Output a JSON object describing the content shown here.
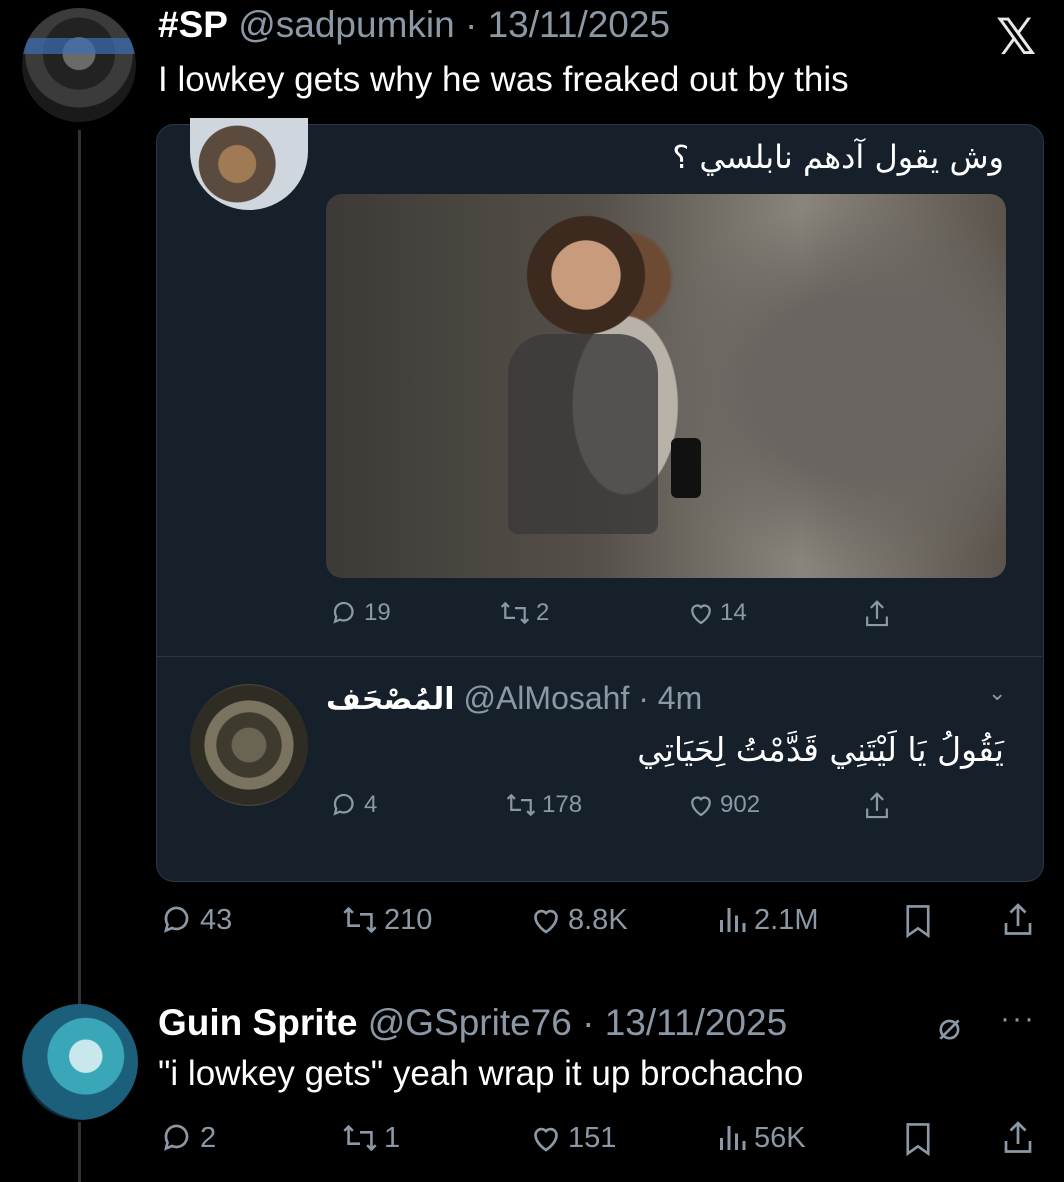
{
  "tweet1": {
    "name": "#SP",
    "handle": "@sadpumkin",
    "dot": " · ",
    "date": "13/11/2025",
    "text": "I lowkey gets why he was freaked out by this",
    "platform_logo": "𝕏",
    "stats": {
      "replies": "43",
      "retweets": "210",
      "likes": "8.8K",
      "views": "2.1M"
    }
  },
  "quote": {
    "post1": {
      "text": "وش يقول آدهم نابلسي ؟",
      "stats": {
        "replies": "19",
        "retweets": "2",
        "likes": "14"
      }
    },
    "post2": {
      "name": "المُصْحَف",
      "handle": "@AlMosahf",
      "dot": " · ",
      "time": "4m",
      "chevron": "⌄",
      "text": "يَقُولُ يَا لَيْتَنِي قَدَّمْتُ لِحَيَاتِي",
      "stats": {
        "replies": "4",
        "retweets": "178",
        "likes": "902"
      }
    }
  },
  "tweet2": {
    "name": "Guin Sprite",
    "handle": "@GSprite76",
    "dot": " · ",
    "date": "13/11/2025",
    "text": "\"i lowkey gets\" yeah wrap it up brochacho",
    "slash_icon": "⌀",
    "more": "···",
    "stats": {
      "replies": "2",
      "retweets": "1",
      "likes": "151",
      "views": "56K"
    }
  },
  "colors": {
    "background": "#000000",
    "card": "#15202b",
    "muted": "#8b98a5",
    "text": "#e7e9ea"
  }
}
